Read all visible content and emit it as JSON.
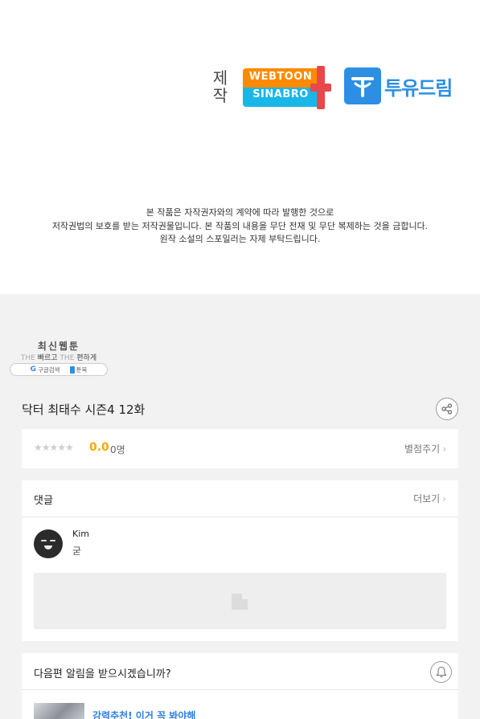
{
  "credits": {
    "label": "제\n작",
    "webtoon_logo_line1": "WEBTOON",
    "webtoon_logo_line2": "SINABRO",
    "tudream_logo_text": "투유드림"
  },
  "notice": {
    "line1": "본 작품은 자작권자와의 계약에 따라 발행한 것으로",
    "line2": "저작권법의 보호를 받는 저작권물입니다. 본 작품의 내용을 무단 전재 및 무단 복제하는 것을 금합니다.",
    "line3": "원작 소설의 스포일러는 자제 부탁드립니다."
  },
  "badge": {
    "title": "최신웹툰",
    "sub_the1": "THE",
    "sub_word1": "빠르고",
    "sub_the2": "THE",
    "sub_word2": "편하게",
    "google_g": "G",
    "search_text": "구글검색",
    "toonbook_text": "툰북"
  },
  "episode": {
    "title": "닥터 최태수 시즌4 12화",
    "share_icon": "share-icon"
  },
  "rating": {
    "stars": "★★★★★",
    "score": "0.0",
    "voters": "0명",
    "rate_link": "별점주기",
    "star_color": "#cfcfcf",
    "score_color": "#f6a800"
  },
  "comments": {
    "header": "댓글",
    "more": "더보기",
    "items": [
      {
        "author": "Kim",
        "text": "굳"
      }
    ]
  },
  "notify": {
    "question": "다음편 알림을 받으시겠습니까?",
    "bell_icon": "bell-icon"
  },
  "recommend": {
    "text": "강력추천! 이거 꼭 봐야해",
    "accent": "#2d7fe3"
  },
  "chevron": "›"
}
